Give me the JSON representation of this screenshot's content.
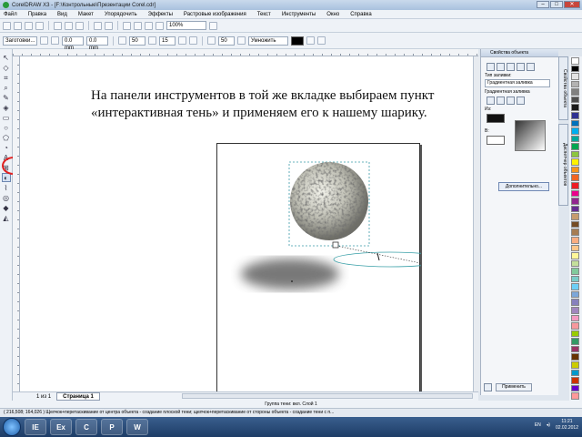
{
  "window": {
    "title": "CorelDRAW X3 - [F:\\Контрольные\\Презентации Corel.cdr]"
  },
  "menu": [
    "Файл",
    "Правка",
    "Вид",
    "Макет",
    "Упорядочить",
    "Эффекты",
    "Растровые изображения",
    "Текст",
    "Инструменты",
    "Окно",
    "Справка"
  ],
  "toolbar1": {
    "zoom": "100%"
  },
  "toolbar2": {
    "preset": "Заготовки...",
    "x": "0.0 mm",
    "y": "0.0 mm",
    "opacity": "50",
    "feather": "15",
    "direction": "50",
    "mode": "Умножить"
  },
  "slide": {
    "text": "На панели инструментов в той же вкладке выбираем пункт «интерактивная тень» и применяем его к нашему шарику."
  },
  "pagebar": {
    "counter": "1 из 1",
    "tab": "Страница 1"
  },
  "status": {
    "line1": "Группа тени: вкл. Слой 1",
    "line2": "( 216,508; 164,026 )  Щелчок+перетаскивание от центра объекта - создание плоской тени; щелчок+перетаскивание от стороны объекта - создание тени с п..."
  },
  "docker": {
    "title": "Свойства объекта",
    "fill_type_label": "Тип заливки:",
    "fill_type_value": "Градиентная заливка",
    "gradient_label": "Градиентная заливка",
    "from_label": "Из:",
    "to_label": "В:",
    "more_button": "Дополнительно...",
    "apply_button": "Применить"
  },
  "sidetabs": [
    "Свойства объекта",
    "Диспетчер объектов"
  ],
  "palette_colors": [
    "#ffffff",
    "#000000",
    "#e4e4e4",
    "#b3b3b3",
    "#808080",
    "#4d4d4d",
    "#1a1a1a",
    "#2e3192",
    "#0072bc",
    "#00aeef",
    "#00a99d",
    "#00a651",
    "#8dc63f",
    "#fff200",
    "#f7941d",
    "#f26522",
    "#ed1c24",
    "#ec008c",
    "#92278f",
    "#662d91",
    "#c69c6d",
    "#754c24",
    "#a67c52",
    "#f9ad81",
    "#fdc68a",
    "#fff799",
    "#c4df9b",
    "#82ca9c",
    "#7accc8",
    "#6dcff6",
    "#7da7d9",
    "#8781bd",
    "#a186be",
    "#f49ac1",
    "#f6989d",
    "#99cc00",
    "#339966",
    "#993366",
    "#663300",
    "#cccc00",
    "#0099cc",
    "#cc3300",
    "#6600cc",
    "#ff9999"
  ],
  "taskbar": {
    "lang": "EN",
    "time": "11:21",
    "date": "02.02.2012",
    "apps": [
      "IE",
      "Ex",
      "C",
      "P",
      "W"
    ]
  }
}
